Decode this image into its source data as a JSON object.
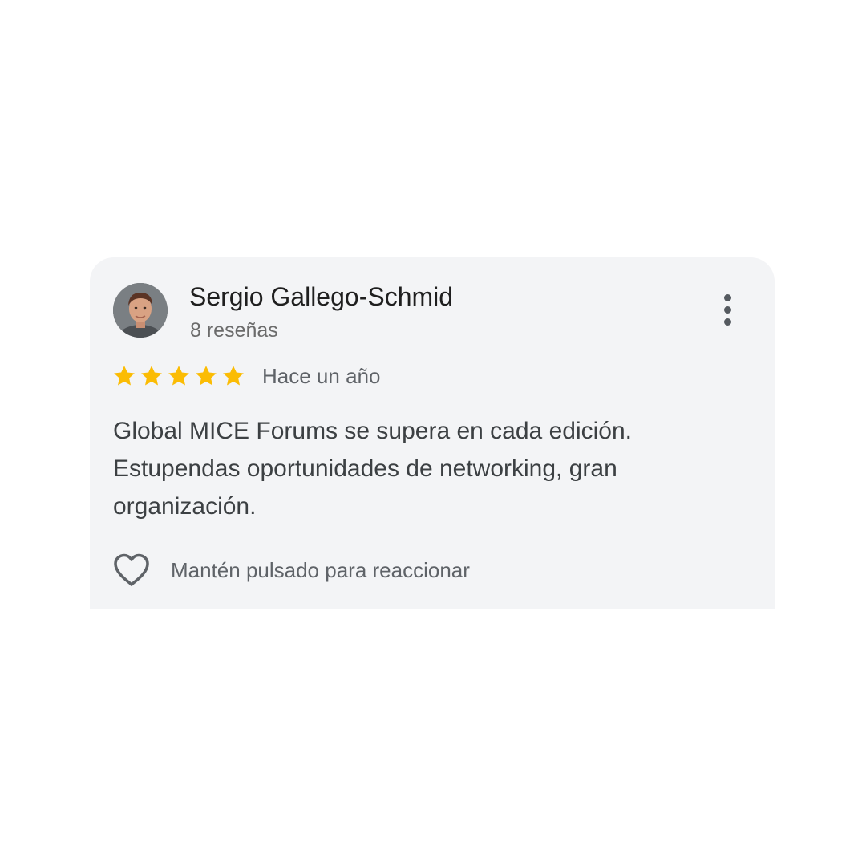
{
  "review": {
    "author_name": "Sergio Gallego-Schmid",
    "review_count": "8 reseñas",
    "rating": 5,
    "rating_max": 5,
    "time_ago": "Hace un año",
    "text": "Global MICE Forums se supera en cada edición. Estupendas oportunidades de networking, gran organización.",
    "reaction_hint": "Mantén pulsado para reaccionar"
  },
  "icons": {
    "more": "more-vertical-icon",
    "star": "star-icon",
    "heart": "heart-outline-icon"
  },
  "colors": {
    "card_background": "#f3f4f6",
    "star": "#fbbc04",
    "primary_text": "#1f1f1f",
    "secondary_text": "#5f6368",
    "body_text": "#3c4043"
  }
}
